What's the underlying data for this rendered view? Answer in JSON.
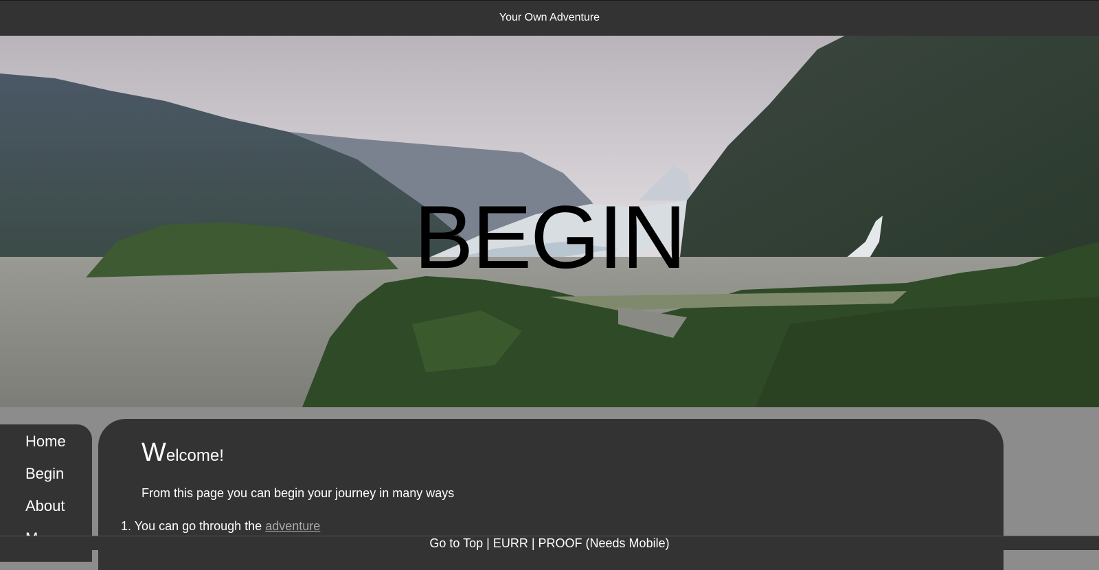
{
  "header": {
    "title": "Your Own Adventure"
  },
  "hero": {
    "title": "BEGIN"
  },
  "sidebar": {
    "items": [
      {
        "label": "Home"
      },
      {
        "label": "Begin"
      },
      {
        "label": "About"
      },
      {
        "label": "M..."
      }
    ]
  },
  "main": {
    "welcome_first": "W",
    "welcome_rest": "elcome!",
    "intro": "From this page you can begin your journey in many ways",
    "list": [
      {
        "number": "1.",
        "text": "You can go through the ",
        "link": "adventure"
      }
    ]
  },
  "footer": {
    "links": [
      {
        "label": "Go to Top"
      },
      {
        "label": "EURR"
      },
      {
        "label": "PROOF (Needs Mobile)"
      }
    ],
    "separator": " | "
  },
  "colors": {
    "bar": "#333333",
    "page_bg": "#8c8c8c",
    "link": "#a8a8a8"
  }
}
